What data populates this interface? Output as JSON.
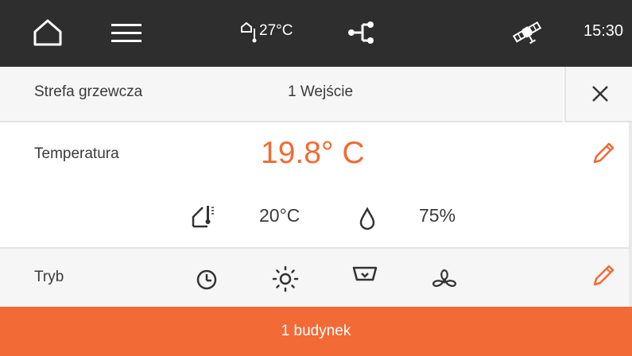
{
  "status_bar": {
    "outdoor_temperature": "27°C",
    "time": "15:30",
    "icons": [
      "home-icon",
      "menu-icon",
      "outdoor-thermometer-icon",
      "network-icon",
      "satellite-icon"
    ]
  },
  "zone": {
    "label": "Strefa grzewcza",
    "value": "1 Wejście"
  },
  "temperature": {
    "label": "Temperatura",
    "current": "19.8° C",
    "setpoint": "20°C",
    "humidity": "75%"
  },
  "mode": {
    "label": "Tryb",
    "icons": [
      "clock-icon",
      "sun-icon",
      "eco-icon",
      "fan-icon"
    ]
  },
  "footer": {
    "label": "1 budynek"
  },
  "colors": {
    "accent": "#f26a35",
    "topbar": "#2e2e2e",
    "row_bg": "#f6f6f6"
  }
}
